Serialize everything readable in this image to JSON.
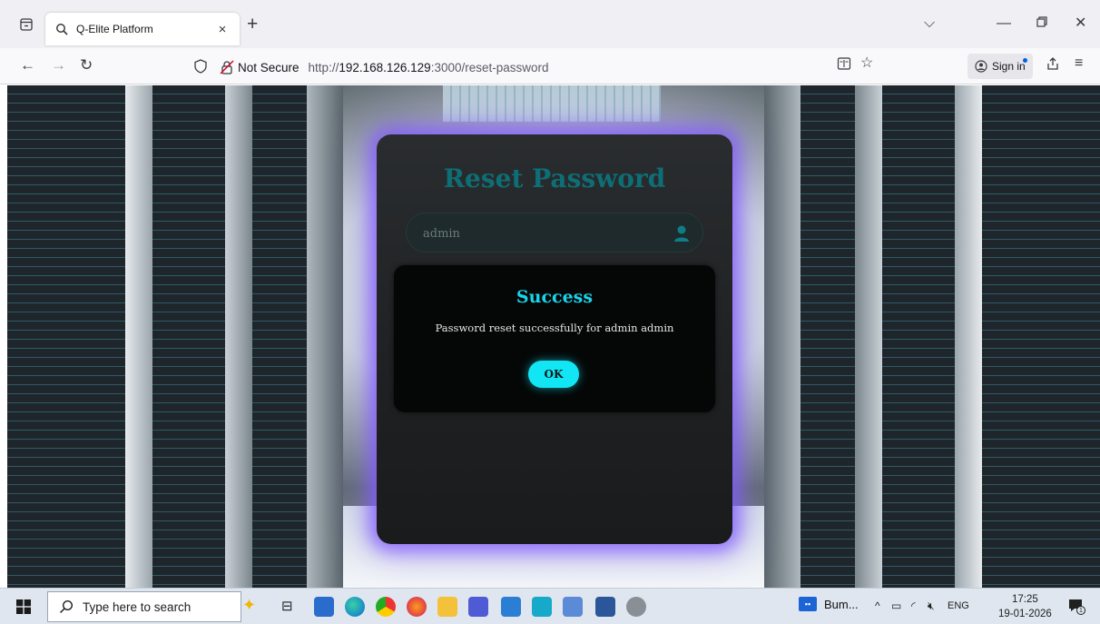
{
  "browser": {
    "tab_title": "Q-Elite Platform",
    "tab_close": "×",
    "new_tab": "+",
    "url_security": "Not Secure",
    "url_prefix": "http://",
    "url_host": "192.168.126.129",
    "url_rest": ":3000/reset-password",
    "sign_in": "Sign in"
  },
  "page": {
    "title": "Reset Password",
    "username_value": "admin"
  },
  "dialog": {
    "title": "Success",
    "message": "Password reset successfully for admin admin",
    "ok_label": "OK"
  },
  "taskbar": {
    "search_placeholder": "Type here to search",
    "app_label": "Bum...",
    "language": "ENG",
    "time": "17:25",
    "date": "19-01-2026",
    "notification_count": "1"
  },
  "colors": {
    "card_glow": "#8a5cff",
    "title_teal": "#0e6e76",
    "dialog_title": "#18d4ea",
    "ok_button": "#12e6f5"
  }
}
